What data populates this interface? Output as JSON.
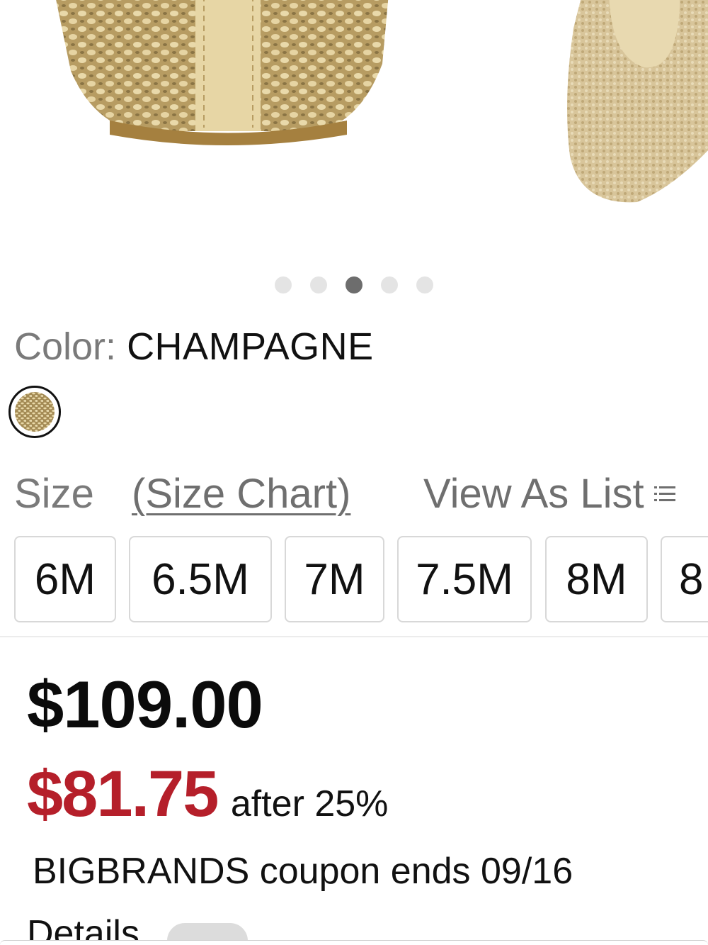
{
  "gallery": {
    "image_alt": "Champagne woven flat shoe",
    "dot_count": 5,
    "active_dot_index": 2
  },
  "color": {
    "label": "Color:",
    "value": "CHAMPAGNE",
    "swatch_color": "#c9b27a"
  },
  "size": {
    "label": "Size",
    "chart_link": "(Size Chart)",
    "view_as_list": "View As List",
    "options": [
      "6M",
      "6.5M",
      "7M",
      "7.5M",
      "8M",
      "8"
    ]
  },
  "pricing": {
    "original_price": "$109.00",
    "sale_price": "$81.75",
    "discount_text": "after 25%",
    "coupon_text": "BIGBRANDS coupon ends 09/16",
    "details_label": "Details",
    "sale_color": "#b51f2a"
  }
}
